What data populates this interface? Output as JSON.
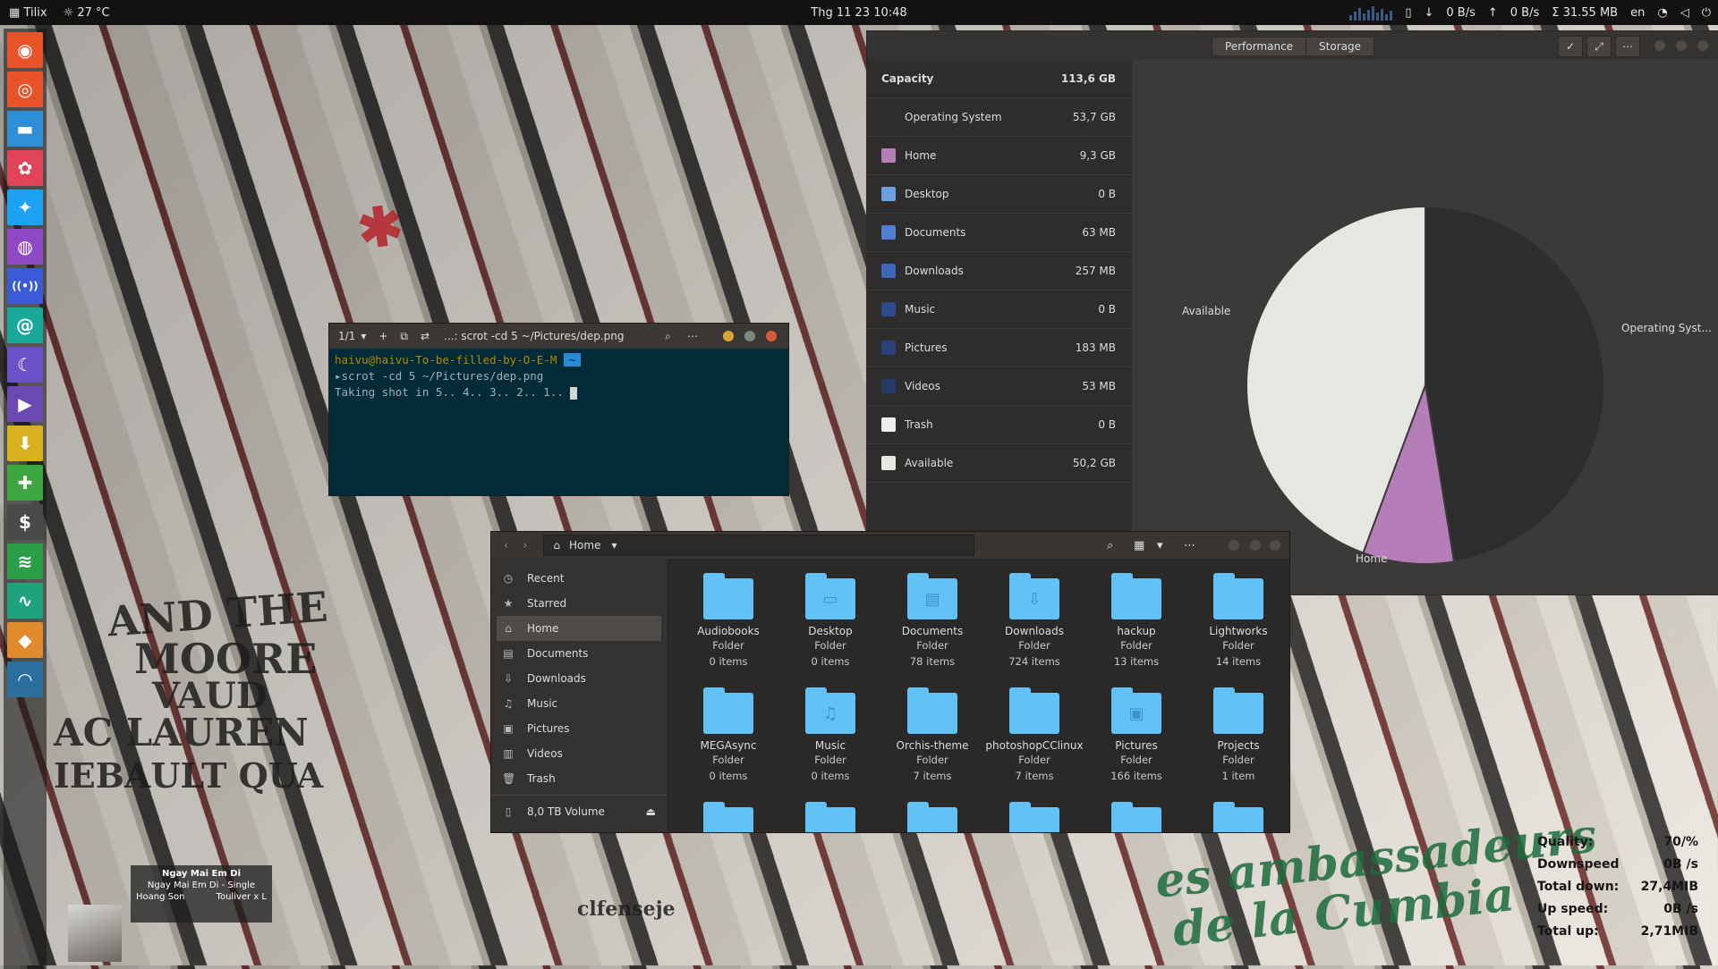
{
  "topbar": {
    "app_name": "Tilix",
    "weather": "27 °C",
    "clock": "Thg 11 23  10:48",
    "down_speed": "0 B/s",
    "up_speed": "0 B/s",
    "memory": "Σ 31.55 MB",
    "language": "en"
  },
  "dock": {
    "items": [
      {
        "icon": "ubuntu-icon",
        "glyph": "◉",
        "color": "#e9532a"
      },
      {
        "icon": "chrome-icon",
        "glyph": "◎",
        "color": "#e9532a"
      },
      {
        "icon": "files-icon",
        "glyph": "▬",
        "color": "#2e8fd6"
      },
      {
        "icon": "pinwheel-icon",
        "glyph": "✿",
        "color": "#e0435a"
      },
      {
        "icon": "twitter-icon",
        "glyph": "✦",
        "color": "#1da1f2"
      },
      {
        "icon": "podcast-icon",
        "glyph": "◍",
        "color": "#8f49c7"
      },
      {
        "icon": "radio-icon",
        "glyph": "((•))",
        "color": "#3b5bd6"
      },
      {
        "icon": "mail-icon",
        "glyph": "@",
        "color": "#1aa89a"
      },
      {
        "icon": "wave-icon",
        "glyph": "☾",
        "color": "#6a52c6"
      },
      {
        "icon": "player-icon",
        "glyph": "▶",
        "color": "#6a4ab0"
      },
      {
        "icon": "download-icon",
        "glyph": "⬇",
        "color": "#d8b21e"
      },
      {
        "icon": "gamepad-icon",
        "glyph": "✚",
        "color": "#3da640"
      },
      {
        "icon": "terminal-dollar-icon",
        "glyph": "$",
        "color": "#4a4a4a"
      },
      {
        "icon": "spotify-icon",
        "glyph": "≋",
        "color": "#2a9d47"
      },
      {
        "icon": "activity-icon",
        "glyph": "∿",
        "color": "#1fa37b"
      },
      {
        "icon": "pineapple-icon",
        "glyph": "◆",
        "color": "#e08a2b"
      },
      {
        "icon": "speedometer-icon",
        "glyph": "◠",
        "color": "#2b6f9e"
      }
    ]
  },
  "storage": {
    "tabs": [
      "Performance",
      "Storage"
    ],
    "capacity_label": "Capacity",
    "capacity_value": "113,6 GB",
    "rows": [
      {
        "name": "Operating System",
        "size": "53,7 GB",
        "color": "#2b2d2f"
      },
      {
        "name": "Home",
        "size": "9,3 GB",
        "color": "#b57eb8"
      },
      {
        "name": "Desktop",
        "size": "0 B",
        "color": "#6f9fe0"
      },
      {
        "name": "Documents",
        "size": "63 MB",
        "color": "#4f7fd0"
      },
      {
        "name": "Downloads",
        "size": "257 MB",
        "color": "#3f67b8"
      },
      {
        "name": "Music",
        "size": "0 B",
        "color": "#2e4a8c"
      },
      {
        "name": "Pictures",
        "size": "183 MB",
        "color": "#29427a"
      },
      {
        "name": "Videos",
        "size": "53 MB",
        "color": "#25396a"
      },
      {
        "name": "Trash",
        "size": "0 B",
        "color": "#eeeeee"
      },
      {
        "name": "Available",
        "size": "50,2 GB",
        "color": "#e6e6e2"
      }
    ],
    "pie_labels": {
      "available": "Available",
      "os": "Operating Syst...",
      "home": "Home"
    },
    "chart_data": {
      "type": "pie",
      "categories": [
        "Operating System",
        "Home",
        "Available"
      ],
      "values": [
        53.7,
        9.3,
        50.2
      ],
      "colors": [
        "#2b2d2f",
        "#b57eb8",
        "#e6e6e2"
      ]
    }
  },
  "terminal": {
    "tab_counter": "1/1",
    "title": "...: scrot -cd 5 ~/Pictures/dep.png",
    "prompt_user": "haivu@haivu-To-be-filled-by-O-E-M",
    "prompt_dir": "~",
    "command": "scrot -cd 5 ~/Pictures/dep.png",
    "output": "Taking shot in 5.. 4.. 3.. 2.. 1.."
  },
  "files": {
    "location": "Home",
    "sidebar": [
      {
        "label": "Recent",
        "icon": "clock-icon",
        "glyph": "◷"
      },
      {
        "label": "Starred",
        "icon": "star-icon",
        "glyph": "★"
      },
      {
        "label": "Home",
        "icon": "home-icon",
        "glyph": "⌂"
      },
      {
        "label": "Documents",
        "icon": "document-icon",
        "glyph": "▤"
      },
      {
        "label": "Downloads",
        "icon": "download-icon",
        "glyph": "⇩"
      },
      {
        "label": "Music",
        "icon": "music-icon",
        "glyph": "♫"
      },
      {
        "label": "Pictures",
        "icon": "picture-icon",
        "glyph": "▣"
      },
      {
        "label": "Videos",
        "icon": "video-icon",
        "glyph": "▥"
      },
      {
        "label": "Trash",
        "icon": "trash-icon",
        "glyph": "🗑"
      }
    ],
    "volume": "8,0 TB Volume",
    "folders": [
      {
        "name": "Audiobooks",
        "type": "Folder",
        "count": "0 items",
        "glyph": ""
      },
      {
        "name": "Desktop",
        "type": "Folder",
        "count": "0 items",
        "glyph": "▭"
      },
      {
        "name": "Documents",
        "type": "Folder",
        "count": "78 items",
        "glyph": "▤"
      },
      {
        "name": "Downloads",
        "type": "Folder",
        "count": "724 items",
        "glyph": "⇩"
      },
      {
        "name": "hackup",
        "type": "Folder",
        "count": "13 items",
        "glyph": ""
      },
      {
        "name": "Lightworks",
        "type": "Folder",
        "count": "14 items",
        "glyph": ""
      },
      {
        "name": "MEGAsync",
        "type": "Folder",
        "count": "0 items",
        "glyph": ""
      },
      {
        "name": "Music",
        "type": "Folder",
        "count": "0 items",
        "glyph": "♫"
      },
      {
        "name": "Orchis-theme",
        "type": "Folder",
        "count": "7 items",
        "glyph": ""
      },
      {
        "name": "photoshopCClinux",
        "type": "Folder",
        "count": "7 items",
        "glyph": ""
      },
      {
        "name": "Pictures",
        "type": "Folder",
        "count": "166 items",
        "glyph": "▣"
      },
      {
        "name": "Projects",
        "type": "Folder",
        "count": "1 item",
        "glyph": ""
      }
    ]
  },
  "music": {
    "song": "Ngay Mai Em Di",
    "album": "Ngay Mai Em Di - Single",
    "artist1": "Hoang Son",
    "artist2": "Touliver x L"
  },
  "stats": [
    {
      "label": "Quality:",
      "value": "70/%"
    },
    {
      "label": "Downspeed",
      "value": "0B /s"
    },
    {
      "label": "Total down:",
      "value": "27,4MIB"
    },
    {
      "label": "Up speed:",
      "value": "0B /s"
    },
    {
      "label": "Total up:",
      "value": "2,71MIB"
    }
  ],
  "wallpaper_text": {
    "a1": "AND THE",
    "a2": "MOORE",
    "a3": "VAUD",
    "a4": "AC LAUREN",
    "a5": "IEBAULT QUA",
    "b1": "es ambassadeurs",
    "b2": "de la Cumbia",
    "b3": "clfenseje"
  }
}
